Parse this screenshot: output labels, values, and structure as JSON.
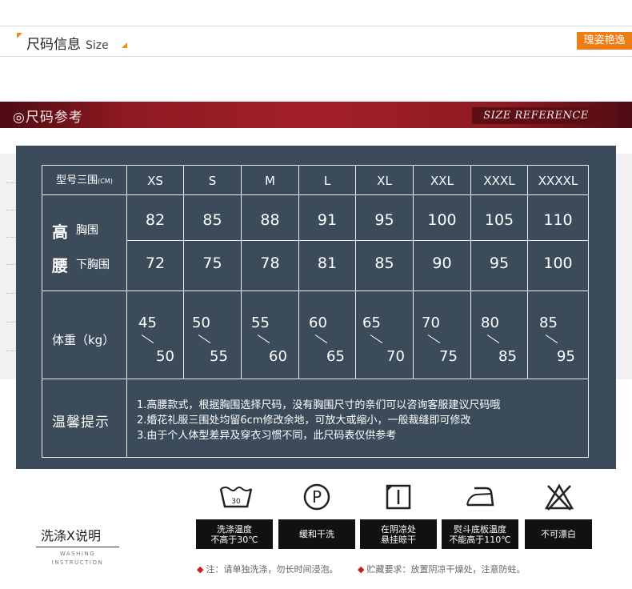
{
  "header": {
    "title_cn": "尺码信息",
    "title_en": "Size",
    "brand": "瑰姿艳逸"
  },
  "banner": {
    "title": "◎尺码参考",
    "subtitle": "SIZE REFERENCE"
  },
  "table": {
    "header_label": "型号三围",
    "header_unit": "(CM)",
    "sizes": [
      "XS",
      "S",
      "M",
      "L",
      "XL",
      "XXL",
      "XXXL",
      "XXXXL"
    ],
    "waist_label_big_1": "高",
    "waist_label_big_2": "腰",
    "bust_label": "胸围",
    "underbust_label": "下胸围",
    "bust": [
      "82",
      "85",
      "88",
      "91",
      "95",
      "100",
      "105",
      "110"
    ],
    "underbust": [
      "72",
      "75",
      "78",
      "81",
      "85",
      "90",
      "95",
      "100"
    ],
    "weight_label": "体重（kg）",
    "weight_low": [
      "45",
      "50",
      "55",
      "60",
      "65",
      "70",
      "80",
      "85"
    ],
    "weight_high": [
      "50",
      "55",
      "60",
      "65",
      "70",
      "75",
      "85",
      "95"
    ],
    "tips_label": "温馨提示",
    "tips": [
      "1.高腰款式，根据胸围选择尺码，没有胸围尺寸的亲们可以咨询客服建议尺码哦",
      "2.婚花礼服三围处均留6cm修改余地，可放大或缩小，一般裁缝即可修改",
      "3.由于个人体型差异及穿衣习惯不同，此尺码表仅供参考"
    ]
  },
  "washing": {
    "title": "洗涤X说明",
    "title_en_1": "WASHING",
    "title_en_2": "INSTRUCTION",
    "wash_temp": "30",
    "care": [
      {
        "icon": "washtub-30-icon",
        "line1": "洗涤温度",
        "line2": "不高于30℃"
      },
      {
        "icon": "circle-p-icon",
        "line1": "缓和干洗",
        "line2": ""
      },
      {
        "icon": "shade-dry-icon",
        "line1": "在阴凉处",
        "line2": "悬挂晾干"
      },
      {
        "icon": "iron-icon",
        "line1": "熨斗底板温度",
        "line2": "不能高于110℃"
      },
      {
        "icon": "no-bleach-icon",
        "line1": "不可漂白",
        "line2": ""
      }
    ],
    "note1": "注：请单独洗涤，勿长时间浸泡。",
    "note2": "贮藏要求：放置阴凉干燥处，注意防蛀。"
  },
  "colors": {
    "accent_orange": "#f07c14",
    "banner_red": "#a32027",
    "panel_slate": "#3b4b5a"
  }
}
